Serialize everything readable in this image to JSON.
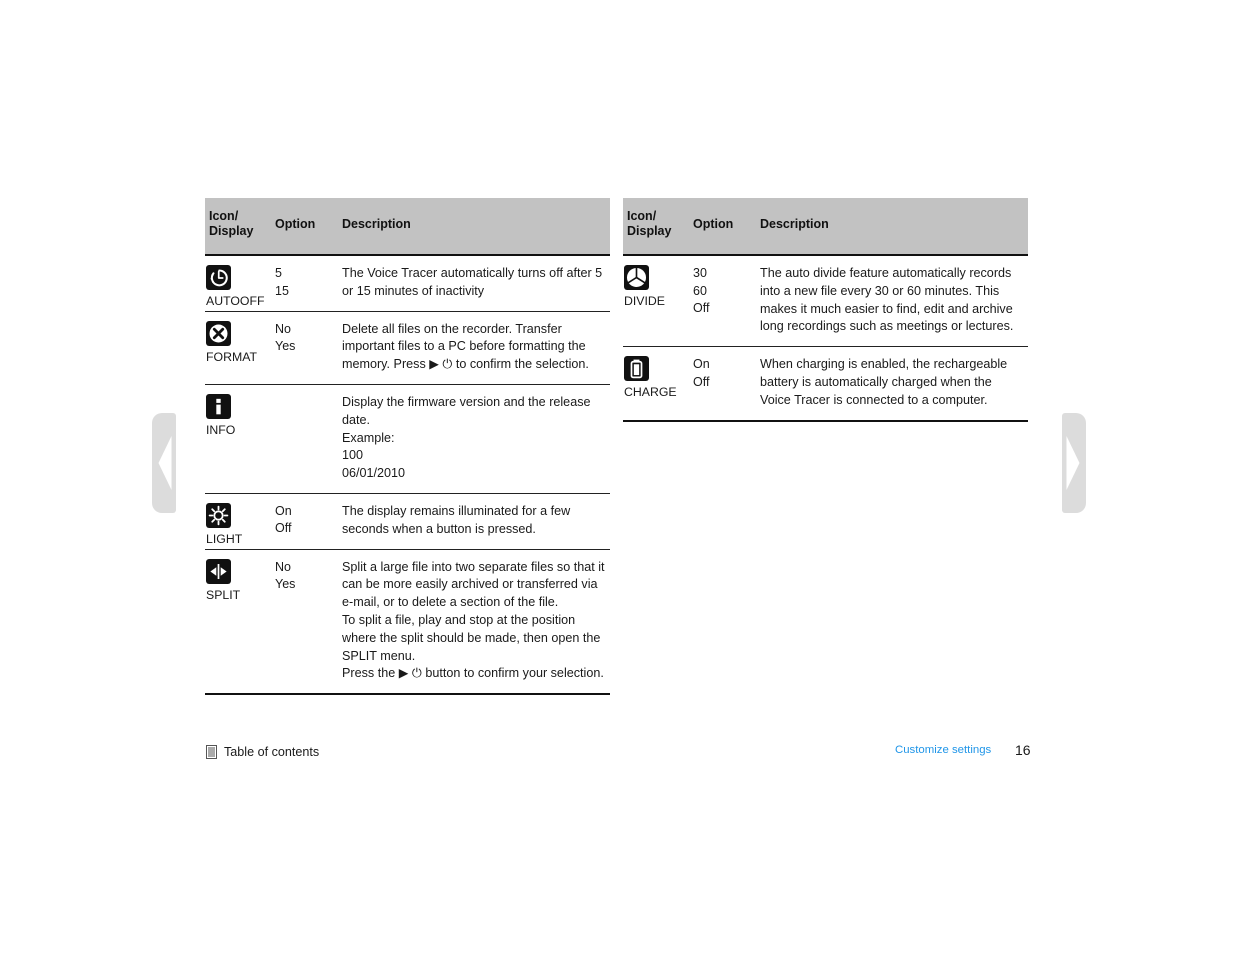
{
  "page": {
    "number": "16",
    "section_link": "Customize settings",
    "toc_label": "Table of contents",
    "toc_icon": "list-icon",
    "nav_left_icon": "prev-page-arrow-icon",
    "nav_right_icon": "next-page-arrow-icon",
    "link_color": "#2196e8",
    "header_bg": "#c2c2c2"
  },
  "tables": [
    {
      "id": "settings-table-left",
      "headers": {
        "icon_display": "Icon/\nDisplay",
        "icon_display_line1": "Icon/",
        "icon_display_line2": "Display",
        "option": "Option",
        "description": "Description"
      },
      "rows": [
        {
          "icon": "autooff-icon",
          "label": "AUTOOFF",
          "options": "5\n15",
          "description": "The Voice Tracer automatically turns off after 5 or 15 minutes of inactivity"
        },
        {
          "icon": "format-icon",
          "label": "FORMAT",
          "options": "No\nYes",
          "description": "Delete all files on the recorder. Transfer important files to a PC before formatting the memory. Press ▶ ⏻ to confirm the selection."
        },
        {
          "icon": "info-icon",
          "label": "INFO",
          "options": "",
          "description": "Display the firmware version and the release date.\nExample:\n100\n06/01/2010"
        },
        {
          "icon": "light-icon",
          "label": "LIGHT",
          "options": "On\nOff",
          "description": "The display remains illuminated for a few seconds when a button is pressed."
        },
        {
          "icon": "split-icon",
          "label": "SPLIT",
          "options": "No\nYes",
          "description": "Split a large file into two separate files so that it can be more easily archived or transferred via e-mail, or to delete a section of the file.\nTo split a file, play and stop at the position where the split should be made, then open the SPLIT menu.\nPress the ▶ ⏻ button to confirm your selection."
        }
      ]
    },
    {
      "id": "settings-table-right",
      "headers": {
        "icon_display": "Icon/\nDisplay",
        "icon_display_line1": "Icon/",
        "icon_display_line2": "Display",
        "option": "Option",
        "description": "Description"
      },
      "rows": [
        {
          "icon": "divide-icon",
          "label": "DIVIDE",
          "options": "30\n60\nOff",
          "description": "The auto divide feature automatically records into a new file every 30 or 60 minutes. This makes it much easier to find, edit and archive long recordings such as meetings or lectures."
        },
        {
          "icon": "charge-icon",
          "label": "CHARGE",
          "options": "On\nOff",
          "description": "When charging is enabled, the rechargeable battery is automatically charged when the Voice Tracer is connected to a computer."
        }
      ]
    }
  ]
}
